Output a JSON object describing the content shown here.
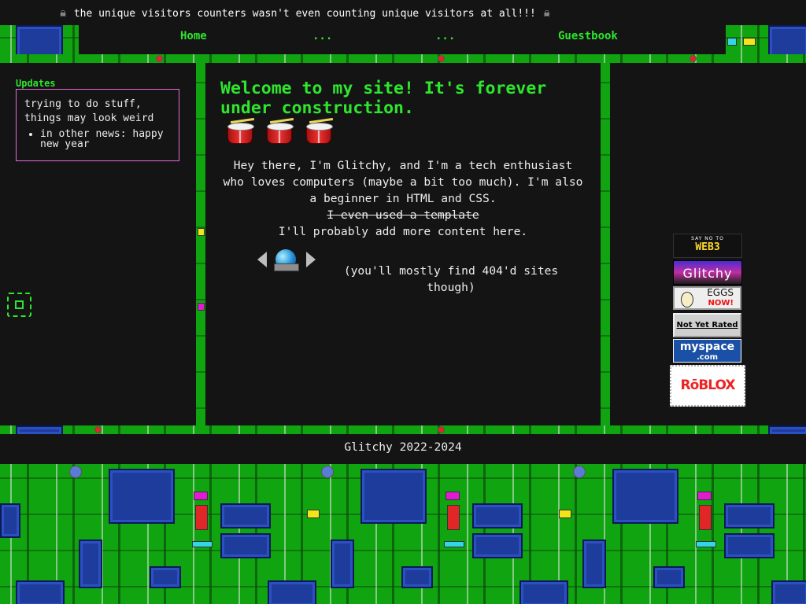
{
  "banner": {
    "notice": "the unique visitors counters wasn't even counting unique visitors at all!!!",
    "icon_left": "skull-icon",
    "icon_right": "skull-icon"
  },
  "nav": {
    "items": [
      "Home",
      "...",
      "...",
      "Guestbook"
    ]
  },
  "sidebar": {
    "updates_title": "Updates",
    "update_text": "trying to do stuff, things may look weird",
    "update_bullet": "in other news: happy new year"
  },
  "main": {
    "welcome": "Welcome to my site! It's forever under construction.",
    "intro_line1": "Hey there, I'm Glitchy, and I'm a tech enthusiast who loves computers (maybe a bit too much). I'm also a beginner in HTML and CSS.",
    "intro_struck": "I even used a template",
    "intro_line2": "I'll probably add more content here.",
    "webring_note": "(you'll mostly find 404'd sites though)"
  },
  "badges": {
    "web3_small": "SAY NO TO",
    "web3_big": "WEB3",
    "glitchy": "Glitchy",
    "eggs": "EGGS",
    "eggs_now": "NOW!",
    "not_yet_rated": "Not Yet Rated",
    "myspace": "myspace",
    "myspace_com": ".com",
    "roblox": "RōBLOX"
  },
  "footer": {
    "text": "Glitchy 2022-2024"
  },
  "colors": {
    "accent": "#2ee62e",
    "background": "#141414",
    "updates_border": "#e86ad8",
    "pcb_green": "#11a411"
  }
}
